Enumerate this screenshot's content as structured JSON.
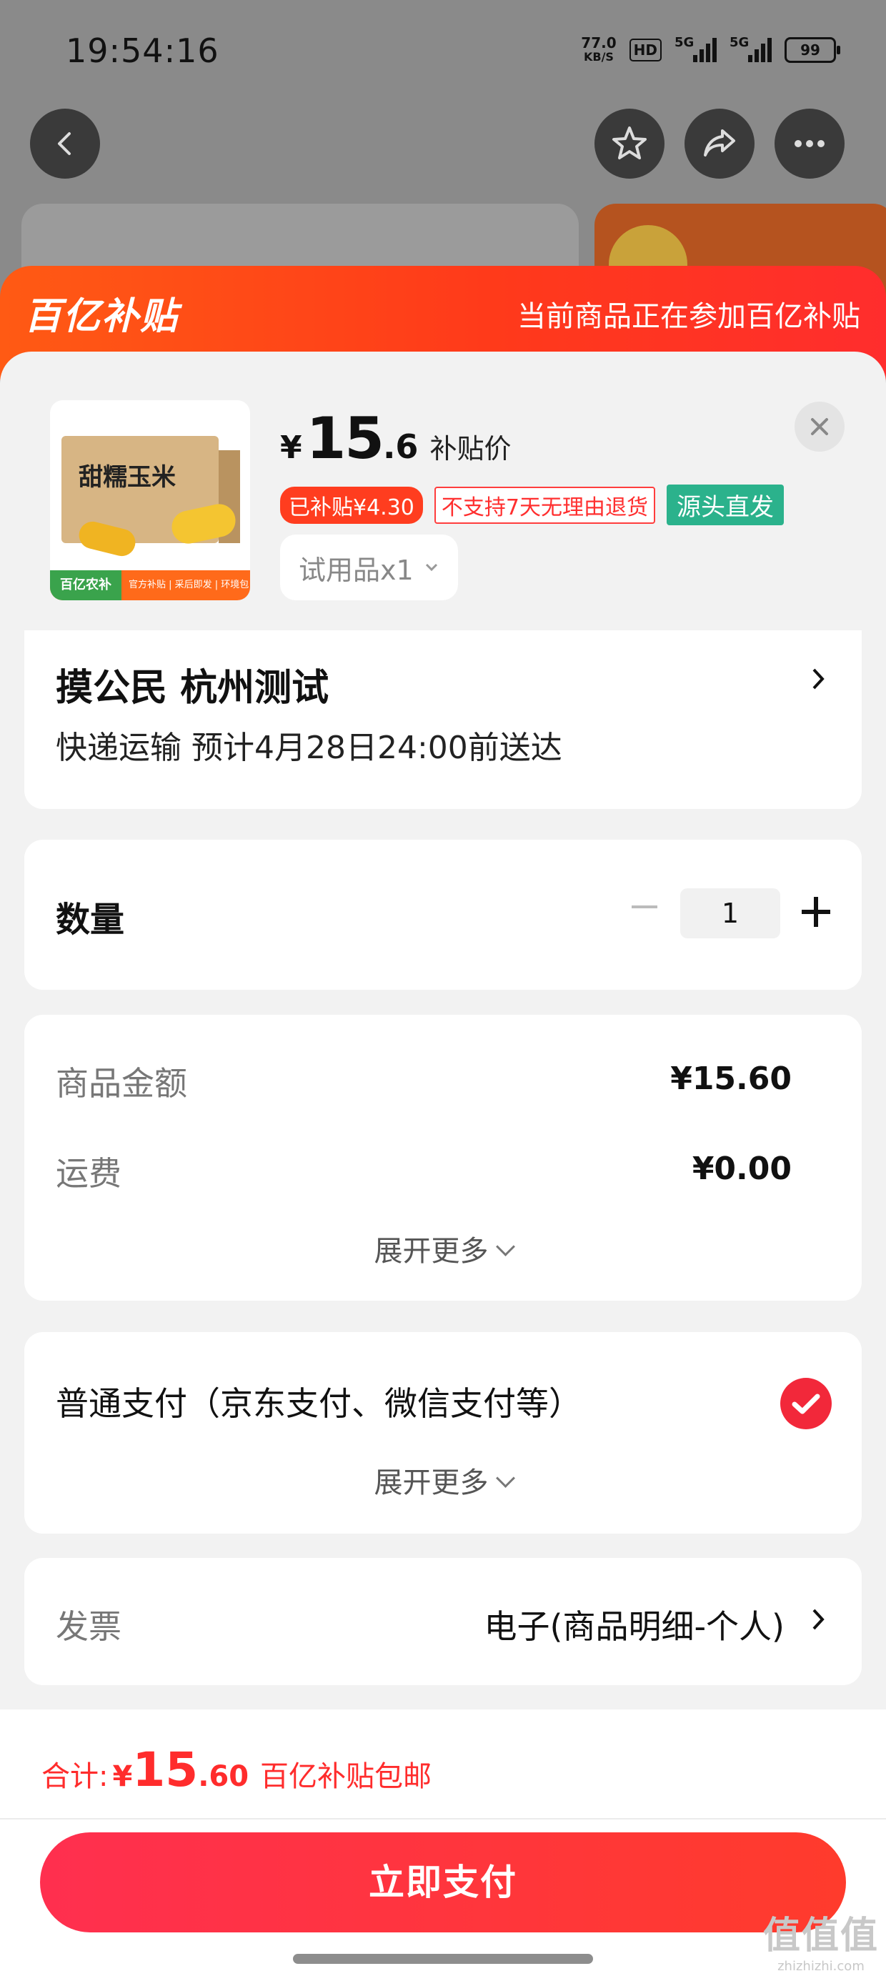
{
  "status_bar": {
    "time": "19:54:16",
    "net_speed_value": "77.0",
    "net_speed_unit": "KB/S",
    "hd_label": "HD",
    "signal1_label": "5G",
    "signal2_label": "5G",
    "battery": "99"
  },
  "sheet": {
    "brand": "百亿补贴",
    "notice": "当前商品正在参加百亿补贴"
  },
  "product": {
    "thumb_title": "甜糯玉米",
    "thumb_strip_brand": "百亿农补",
    "thumb_strip_text": "官方补贴 | 采后即发 | 环境包装",
    "currency": "¥",
    "price_int": "15",
    "price_dec": ".6",
    "price_label": "补贴价",
    "tag_subsidy": "已补贴¥4.30",
    "tag_noreturn": "不支持7天无理由退货",
    "tag_direct": "源头直发",
    "spec": "试用品x1"
  },
  "address": {
    "name": "摸公民  杭州测试",
    "delivery": "快递运输 预计4月28日24:00前送达"
  },
  "quantity": {
    "label": "数量",
    "value": "1"
  },
  "amount": {
    "goods_label": "商品金额",
    "goods_value": "¥15.60",
    "shipping_label": "运费",
    "shipping_value": "¥0.00",
    "expand_label": "展开更多"
  },
  "payment": {
    "method": "普通支付（京东支付、微信支付等）",
    "expand_label": "展开更多",
    "selected": true
  },
  "invoice": {
    "label": "发票",
    "value": "电子(商品明细-个人)"
  },
  "footer": {
    "total_label": "合计:",
    "total_currency": "¥",
    "total_int": "15",
    "total_dec": ".60",
    "total_note": "百亿补贴包邮",
    "pay_button": "立即支付"
  },
  "watermark": {
    "text": "值值值",
    "url": "zhizhizhi.com"
  },
  "colors": {
    "accent": "#ff2c2c",
    "brand_gradient_start": "#ff5a14",
    "tag_green": "#2bb28c"
  }
}
